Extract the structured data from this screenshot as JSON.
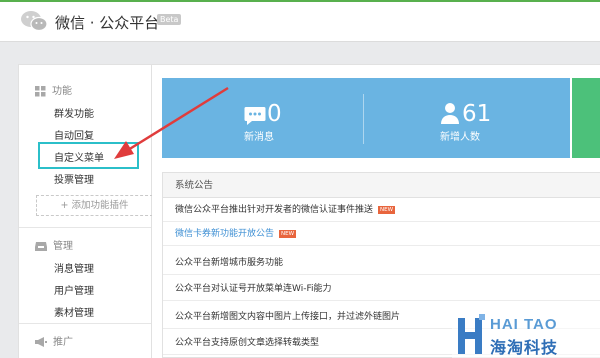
{
  "header": {
    "brand": "微信 · 公众平台",
    "badge": "Beta"
  },
  "sidebar": {
    "sections": [
      {
        "label": "功能",
        "icon": "grid-icon"
      },
      {
        "label": "管理",
        "icon": "inbox-icon"
      },
      {
        "label": "推广",
        "icon": "megaphone-icon"
      }
    ],
    "function_items": [
      "群发功能",
      "自动回复",
      "自定义菜单",
      "投票管理"
    ],
    "add_plugin": "+ 添加功能插件",
    "manage_items": [
      "消息管理",
      "用户管理",
      "素材管理"
    ]
  },
  "stats": [
    {
      "value": "0",
      "label": "新消息",
      "icon": "message-icon"
    },
    {
      "value": "61",
      "label": "新增人数",
      "icon": "user-icon"
    }
  ],
  "notice": {
    "title": "系统公告",
    "rows": [
      {
        "text": "微信公众平台推出针对开发者的微信认证事件推送",
        "new": "NEW"
      },
      {
        "text": "微信卡券新功能开放公告",
        "new": "NEW"
      },
      {
        "text": "公众平台新增城市服务功能"
      },
      {
        "text": "公众平台对认证号开放菜单连Wi-Fi能力"
      },
      {
        "text": "公众平台新增图文内容中图片上传接口，并过滤外链图片"
      },
      {
        "text": "公众平台支持原创文章选择转载类型"
      }
    ]
  },
  "watermark": {
    "top": "HAI TAO",
    "bottom": "海淘科技"
  },
  "colors": {
    "accent_green": "#58b04e",
    "stat_blue": "#6ab4e2",
    "highlight": "#2bbfc9",
    "arrow": "#e03c3c",
    "link": "#3f90d4"
  }
}
